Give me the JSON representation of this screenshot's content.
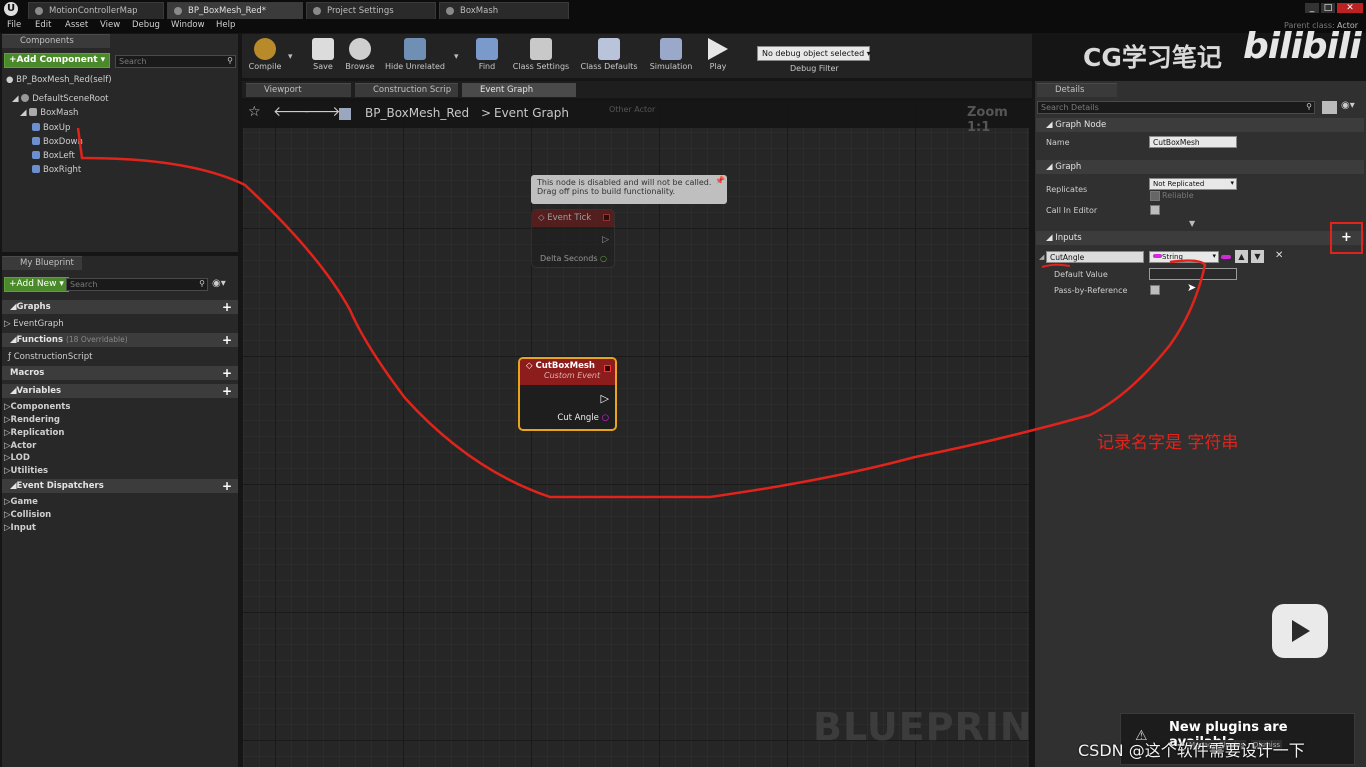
{
  "tabs": [
    "MotionControllerMap",
    "BP_BoxMesh_Red*",
    "Project Settings",
    "BoxMash"
  ],
  "titlebar": {
    "parent_class_label": "Parent class:",
    "parent_class_value": "Actor"
  },
  "menu": [
    "File",
    "Edit",
    "Asset",
    "View",
    "Debug",
    "Window",
    "Help"
  ],
  "components": {
    "title": "Components",
    "add_button": "+Add Component",
    "search_placeholder": "Search",
    "self": "BP_BoxMesh_Red(self)",
    "tree": [
      "DefaultSceneRoot",
      "BoxMash",
      "BoxUp",
      "BoxDown",
      "BoxLeft",
      "BoxRight"
    ]
  },
  "myblueprint": {
    "title": "My Blueprint",
    "add_button": "+Add New",
    "search_placeholder": "Search",
    "graphs_label": "Graphs",
    "graphs_item": "EventGraph",
    "functions_label": "Functions",
    "functions_count": "(18 Overridable)",
    "functions_item": "ConstructionScript",
    "macros_label": "Macros",
    "variables_label": "Variables",
    "variable_cats": [
      "Components",
      "Rendering",
      "Replication",
      "Actor",
      "LOD",
      "Utilities"
    ],
    "dispatchers_label": "Event Dispatchers",
    "dispatcher_cats": [
      "Game",
      "Collision",
      "Input"
    ]
  },
  "toolbar": {
    "items": [
      "Compile",
      "Save",
      "Browse",
      "Hide Unrelated",
      "Find",
      "Class Settings",
      "Class Defaults",
      "Simulation",
      "Play"
    ],
    "debug_select": "No debug object selected",
    "debug_label": "Debug Filter"
  },
  "editor_tabs": [
    "Viewport",
    "Construction Scrip",
    "Event Graph"
  ],
  "graph": {
    "breadcrumb_bp": "BP_BoxMesh_Red",
    "breadcrumb_sep": ">",
    "breadcrumb_graph": "Event Graph",
    "other_actor": "Other Actor",
    "zoom": "Zoom 1:1",
    "watermark": "BLUEPRINT",
    "disabled_note": "This node is disabled and will not be called.\nDrag off pins to build functionality.",
    "tick_node": {
      "title": "Event Tick",
      "pin": "Delta Seconds"
    },
    "custom_node": {
      "title": "CutBoxMesh",
      "subtitle": "Custom Event",
      "pin": "Cut Angle"
    }
  },
  "details": {
    "title": "Details",
    "search_placeholder": "Search Details",
    "graph_node_section": "Graph Node",
    "name_label": "Name",
    "name_value": "CutBoxMesh",
    "graph_section": "Graph",
    "replicates_label": "Replicates",
    "replicates_value": "Not Replicated",
    "reliable_label": "Reliable",
    "call_in_editor_label": "Call In Editor",
    "inputs_section": "Inputs",
    "input_name": "CutAngle",
    "input_type": "String",
    "default_value_label": "Default Value",
    "pass_by_ref_label": "Pass-by-Reference"
  },
  "overlay": {
    "brand": "CG学习笔记",
    "brand_logo": "bilibili",
    "annotation": "记录名字是 字符串",
    "notification": "New plugins are available",
    "notif_sub1": "Manage Plugins",
    "notif_sub2": "Dismiss",
    "credit": "CSDN @这个软件需要设计一下"
  },
  "colors": {
    "accent_red": "#e0241b",
    "green": "#4b8a2b",
    "node_header": "#8d1c1c",
    "string_pin": "#d12adb"
  }
}
